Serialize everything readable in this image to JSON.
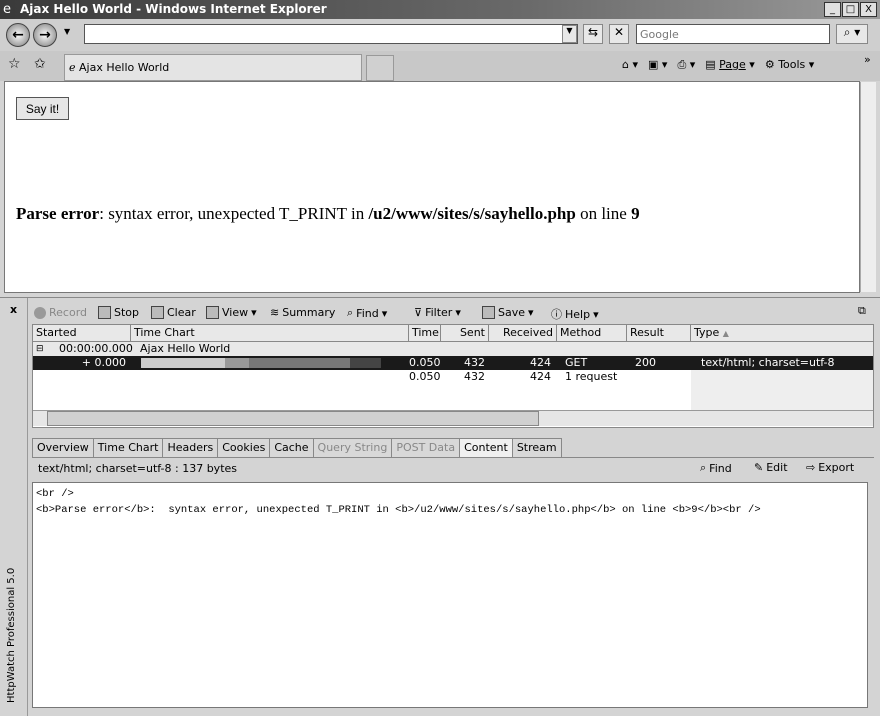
{
  "window": {
    "title": "Ajax Hello World - Windows Internet Explorer"
  },
  "browser": {
    "address": "",
    "search_placeholder": "Google",
    "tab_label": "Ajax Hello World",
    "page_label": "Page",
    "tools_label": "Tools"
  },
  "page": {
    "button_label": "Say it!",
    "error_label": "Parse error",
    "error_text": ": syntax error, unexpected T_PRINT in ",
    "error_path": "/u2/www/sites/s/sayhello.php",
    "error_on": " on line ",
    "error_line": "9"
  },
  "httpwatch": {
    "product": "HttpWatch Professional 5.0",
    "toolbar": {
      "record": "Record",
      "stop": "Stop",
      "clear": "Clear",
      "view": "View",
      "summary": "Summary",
      "find": "Find",
      "filter": "Filter",
      "save": "Save",
      "help": "Help"
    },
    "columns": [
      "Started",
      "Time Chart",
      "Time",
      "Sent",
      "Received",
      "Method",
      "Result",
      "Type"
    ],
    "group": {
      "started": "00:00:00.000",
      "title": "Ajax Hello World"
    },
    "rows": [
      {
        "started": "+ 0.000",
        "time": "0.050",
        "sent": "432",
        "received": "424",
        "method": "GET",
        "result": "200",
        "type": "text/html; charset=utf-8"
      }
    ],
    "summary": {
      "time": "0.050",
      "sent": "432",
      "received": "424",
      "method": "1 request"
    },
    "tabs": [
      "Overview",
      "Time Chart",
      "Headers",
      "Cookies",
      "Cache",
      "Query String",
      "POST Data",
      "Content",
      "Stream"
    ],
    "active_tab": "Content",
    "content_info": "text/html; charset=utf-8 : 137 bytes",
    "content_actions": {
      "find": "Find",
      "edit": "Edit",
      "export": "Export"
    },
    "content_lines": [
      "<br />",
      "<b>Parse error</b>:  syntax error, unexpected T_PRINT in <b>/u2/www/sites/s/sayhello.php</b> on line <b>9</b><br />"
    ]
  }
}
